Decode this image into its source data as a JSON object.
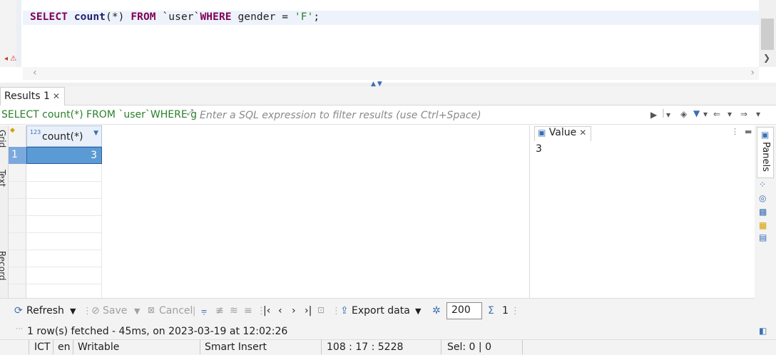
{
  "editor": {
    "sql": {
      "kw_select": "SELECT",
      "fn_count": "count",
      "paren": "(*) ",
      "kw_from": "FROM",
      "table": " `user`",
      "kw_where": "WHERE",
      "cond": " gender = ",
      "str": "'F'",
      "semi": ";"
    }
  },
  "results": {
    "tab_label": "Results 1",
    "query_text": "SELECT count(*) FROM `user`WHERE g",
    "filter_placeholder": "Enter a SQL expression to filter results (use Ctrl+Space)",
    "side_tabs": [
      "Grid",
      "Text",
      "Record"
    ],
    "column_header": "count(*)",
    "column_type_badge": "123",
    "row_number": "1",
    "cell_value": "3"
  },
  "value_panel": {
    "tab_label": "Value",
    "value": "3",
    "panels_label": "Panels"
  },
  "toolbar": {
    "refresh": "Refresh",
    "save": "Save",
    "cancel": "Cancel",
    "export": "Export data",
    "fetch_size": "200",
    "row_count": "1"
  },
  "status": {
    "message": "1 row(s) fetched - 45ms, on 2023-03-19 at 12:02:26",
    "timezone": "ICT",
    "locale": "en",
    "mode": "Writable",
    "insert_mode": "Smart Insert",
    "cursor": "108 : 17 : 5228",
    "selection": "Sel: 0 | 0"
  },
  "icons": {
    "accent": "#3a6fb5",
    "keyword_color": "#7f0055",
    "query_color": "#2a7f2a"
  }
}
